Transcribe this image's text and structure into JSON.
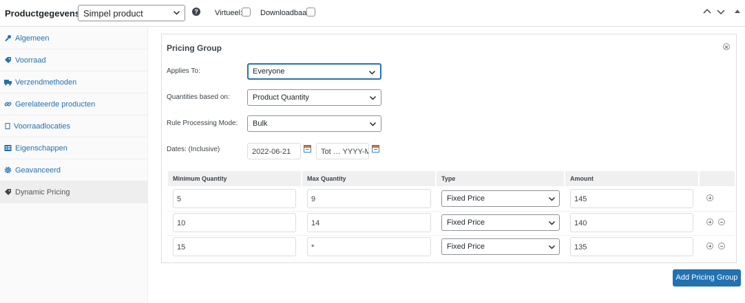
{
  "header": {
    "title": "Productgegevens —",
    "product_type": "Simpel product",
    "help": "?",
    "virtual_label": "Virtueel:",
    "downloadable_label": "Downloadbaar:"
  },
  "sidebar": {
    "items": [
      {
        "label": "Algemeen",
        "icon": "wrench-icon"
      },
      {
        "label": "Voorraad",
        "icon": "tag-icon"
      },
      {
        "label": "Verzendmethoden",
        "icon": "truck-icon"
      },
      {
        "label": "Gerelateerde producten",
        "icon": "link-icon"
      },
      {
        "label": "Voorraadlocaties",
        "icon": "box-icon"
      },
      {
        "label": "Eigenschappen",
        "icon": "list-icon"
      },
      {
        "label": "Geavanceerd",
        "icon": "gear-icon"
      },
      {
        "label": "Dynamic Pricing",
        "icon": "tag-icon",
        "active": true
      }
    ]
  },
  "pricing_group": {
    "title": "Pricing Group",
    "applies_to_label": "Applies To:",
    "applies_to_value": "Everyone",
    "quantities_label": "Quantities based on:",
    "quantities_value": "Product Quantity",
    "mode_label": "Rule Processing Mode:",
    "mode_value": "Bulk",
    "dates_label": "Dates: (Inclusive)",
    "date_from": "2022-06-21",
    "date_to_placeholder": "Tot … YYYY-M",
    "columns": [
      "Minimum Quantity",
      "Max Quantity",
      "Type",
      "Amount"
    ],
    "rows": [
      {
        "min": "5",
        "max": "9",
        "type": "Fixed Price",
        "amount": "145"
      },
      {
        "min": "10",
        "max": "14",
        "type": "Fixed Price",
        "amount": "140"
      },
      {
        "min": "15",
        "max": "*",
        "type": "Fixed Price",
        "amount": "135"
      }
    ]
  },
  "add_button": "Add Pricing Group",
  "colors": {
    "accent": "#2271b1",
    "link": "#2271b1",
    "border": "#dcdcde"
  }
}
